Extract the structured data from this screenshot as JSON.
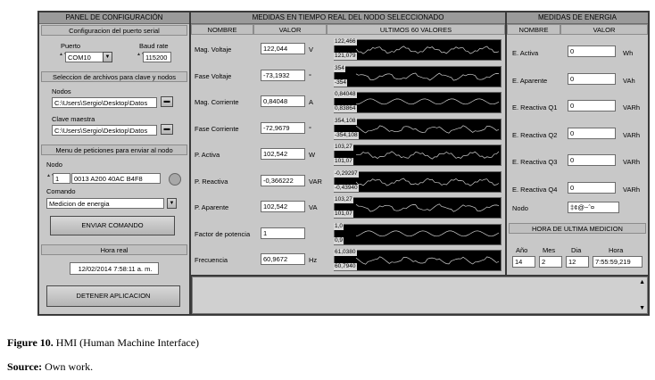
{
  "config": {
    "title": "PANEL DE CONFIGURACIÓN",
    "serial_header": "Configuracion del puerto serial",
    "port_label": "Puerto",
    "port_value": "COM10",
    "baud_label": "Baud rate",
    "baud_value": "115200",
    "files_header": "Seleccion de archivos para clave y nodos",
    "nodes_label": "Nodos",
    "nodes_path": "C:\\Users\\Sergio\\Desktop\\Datos",
    "key_label": "Clave maestra",
    "key_path": "C:\\Users\\Sergio\\Desktop\\Datos",
    "menu_header": "Menu de peticiones para enviar al nodo",
    "node_label": "Nodo",
    "node_index": "1",
    "node_address": "0013 A200 40AC B4F8",
    "command_label": "Comando",
    "command_value": "Medicion de energia",
    "send_button": "ENVIAR COMANDO",
    "time_header": "Hora real",
    "time_value": "12/02/2014 7:58:11 a. m.",
    "stop_button": "DETENER APLICACION"
  },
  "measures": {
    "title": "MEDIDAS EN TIEMPO REAL DEL NODO SELECCIONADO",
    "col_name": "NOMBRE",
    "col_value": "VALOR",
    "col_last": "ULTIMOS 60 VALORES",
    "rows": [
      {
        "name": "Mag. Voltaje",
        "value": "122,044",
        "unit": "V",
        "top": "122,466",
        "bottom": "121,079"
      },
      {
        "name": "Fase Voltaje",
        "value": "-73,1932",
        "unit": "°",
        "top": "354",
        "bottom": "-354"
      },
      {
        "name": "Mag. Corriente",
        "value": "0,84048",
        "unit": "A",
        "top": "0,84048",
        "bottom": "0,83864"
      },
      {
        "name": "Fase Corriente",
        "value": "-72,9679",
        "unit": "°",
        "top": "354,108",
        "bottom": "-354,108"
      },
      {
        "name": "P. Activa",
        "value": "102,542",
        "unit": "W",
        "top": "103,27",
        "bottom": "101,07"
      },
      {
        "name": "P. Reactiva",
        "value": "-0,366222",
        "unit": "VAR",
        "top": "-0,29297",
        "bottom": "-0,43940"
      },
      {
        "name": "P. Aparente",
        "value": "102,542",
        "unit": "VA",
        "top": "103,27",
        "bottom": "101,07"
      },
      {
        "name": "Factor de potencia",
        "value": "1",
        "unit": "",
        "top": "1,0",
        "bottom": "0,9"
      },
      {
        "name": "Frecuencia",
        "value": "60,9672",
        "unit": "Hz",
        "top": "61,0380",
        "bottom": "60,7940"
      }
    ]
  },
  "energy": {
    "title": "MEDIDAS DE ENERGIA",
    "col_name": "NOMBRE",
    "col_value": "VALOR",
    "rows": [
      {
        "name": "E. Activa",
        "value": "0",
        "unit": "Wh"
      },
      {
        "name": "E. Aparente",
        "value": "0",
        "unit": "VAh"
      },
      {
        "name": "E. Reactiva Q1",
        "value": "0",
        "unit": "VARh"
      },
      {
        "name": "E. Reactiva Q2",
        "value": "0",
        "unit": "VARh"
      },
      {
        "name": "E. Reactiva Q3",
        "value": "0",
        "unit": "VARh"
      },
      {
        "name": "E. Reactiva Q4",
        "value": "0",
        "unit": "VARh"
      }
    ],
    "node_label": "Nodo",
    "node_value": "‡¢@~ˆ¤"
  },
  "last_measure": {
    "title": "HORA DE ULTIMA MEDICION",
    "year_label": "Año",
    "year_value": "14",
    "month_label": "Mes",
    "month_value": "2",
    "day_label": "Dia",
    "day_value": "12",
    "hour_label": "Hora",
    "hour_value": "7:55:59,219"
  },
  "figure": {
    "caption_bold": "Figure 10.",
    "caption_text": " HMI (Human Machine Interface)",
    "source_bold": "Source:",
    "source_text": " Own work."
  }
}
